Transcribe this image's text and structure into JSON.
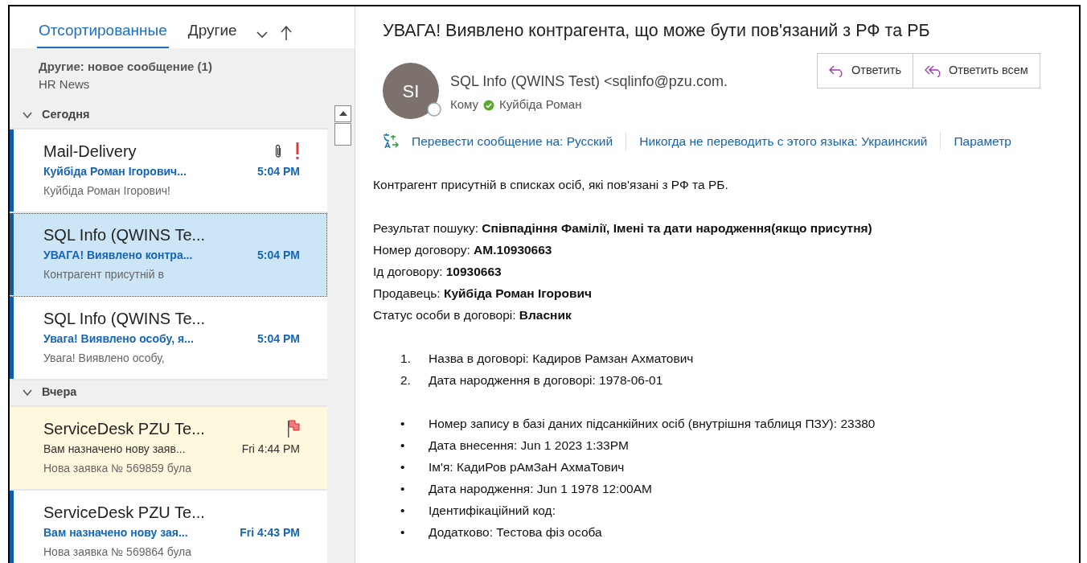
{
  "tabs": [
    {
      "label": "Отсортированные",
      "selected": true
    },
    {
      "label": "Другие",
      "selected": false
    }
  ],
  "notice": {
    "title": "Другие: новое сообщение (1)",
    "text": "HR News"
  },
  "groups": [
    {
      "label": "Сегодня",
      "expanded": true,
      "messages": [
        {
          "sender": "Mail-Delivery",
          "subject": "Куйбіда Роман Ігорович...",
          "preview": "Куйбіда Роман Ігорович!",
          "time": "5:04 PM",
          "unread": true,
          "selected": false,
          "flagged": false,
          "attachment": true,
          "important": true
        },
        {
          "sender": "SQL Info (QWINS Te...",
          "subject": "УВАГА! Виявлено контра...",
          "preview": "Контрагент присутній в",
          "time": "5:04 PM",
          "unread": true,
          "selected": true,
          "flagged": false,
          "attachment": false,
          "important": false
        },
        {
          "sender": "SQL Info (QWINS Te...",
          "subject": "Увага! Виявлено особу, я...",
          "preview": "Увага!  Виявлено особу,",
          "time": "5:04 PM",
          "unread": true,
          "selected": false,
          "flagged": false,
          "attachment": false,
          "important": false
        }
      ]
    },
    {
      "label": "Вчера",
      "expanded": true,
      "messages": [
        {
          "sender": "ServiceDesk PZU Te...",
          "subject": "Вам назначено нову заяв...",
          "preview": "Нова заявка № 569859 була",
          "time": "Fri 4:44 PM",
          "unread": false,
          "selected": false,
          "flagged": true,
          "attachment": false,
          "important": false
        },
        {
          "sender": "ServiceDesk PZU Te...",
          "subject": "Вам назначено нову зая...",
          "preview": "Нова заявка № 569864 була",
          "time": "Fri 4:43 PM",
          "unread": true,
          "selected": false,
          "flagged": false,
          "attachment": false,
          "important": false
        }
      ]
    }
  ],
  "reading": {
    "subject": "УВАГА! Виявлено контрагента, що може бути пов'язаний з РФ та РБ",
    "avatar": "SI",
    "sender": "SQL Info (QWINS Test) <sqlinfo@pzu.com.",
    "to_label": "Кому",
    "recipient": "Куйбіда  Роман",
    "actions": [
      "Ответить",
      "Ответить всем"
    ],
    "translate": [
      "Перевести сообщение на: Русский",
      "Никогда не переводить с этого языка: Украинский",
      "Параметр"
    ],
    "intro": "Контрагент присутній в списках осіб, які пов'язані з РФ та РБ.",
    "fields": [
      "Результат пошуку: **Співпадіння Фамілії, Імені та дати народження(якщо присутня)**",
      "Номер договору: **АМ.10930663**",
      "Ід договору: **10930663**",
      "Продавець: **Куйбіда Роман Ігорович**",
      "Статус особи в договорі: **Власник**"
    ],
    "numbered": [
      {
        "marker": "1.",
        "text": "Назва в договорі: Кадиров Рамзан Ахматович"
      },
      {
        "marker": "2.",
        "text": "Дата народження в договорі: 1978-06-01"
      }
    ],
    "bullets": [
      {
        "marker": "•",
        "text": "Номер запису в базі даних підсанкійних осіб (внутрішня таблиця ПЗУ): 23380"
      },
      {
        "marker": "•",
        "text": "Дата внесення: Jun 1 2023 1:33PM"
      },
      {
        "marker": "•",
        "text": "Ім'я: КадиРов рАмЗаН АхмаТович"
      },
      {
        "marker": "•",
        "text": "Дата народження: Jun 1 1978 12:00AM"
      },
      {
        "marker": "•",
        "text": "Ідентифікаційний код:"
      },
      {
        "marker": "•",
        "text": "Додатково: Тестова фіз особа"
      }
    ]
  }
}
